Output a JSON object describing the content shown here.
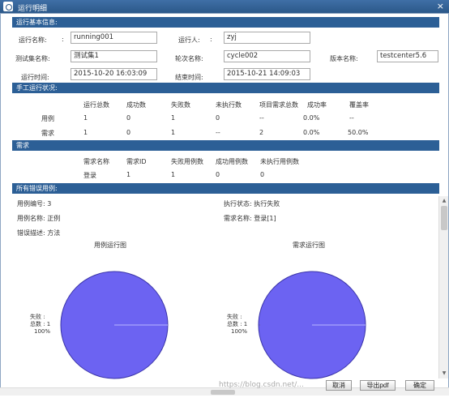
{
  "window": {
    "title": "运行明细",
    "close": "×"
  },
  "sections": {
    "basic": "运行基本信息:",
    "manual": "手工运行状况:",
    "req": "需求",
    "errors": "所有错误用例:"
  },
  "basic": {
    "run_name_label": "运行名称:",
    "run_name": "running001",
    "runner_label": "运行人:",
    "runner": "zyj",
    "testset_label": "测试集名称:",
    "testset": "测试集1",
    "cycle_label": "轮次名称:",
    "cycle": "cycle002",
    "version_label": "版本名称:",
    "version": "testcenter5.6",
    "run_time_label": "运行时间:",
    "run_time": "2015-10-20 16:03:09",
    "end_time_label": "结束时间:",
    "end_time": "2015-10-21 14:09:03"
  },
  "manual": {
    "headers": [
      "运行总数",
      "成功数",
      "失败数",
      "未执行数",
      "项目需求总数",
      "成功率",
      "覆盖率"
    ],
    "rows": [
      {
        "label": "用例",
        "cells": [
          "1",
          "0",
          "1",
          "0",
          "--",
          "0.0%",
          "--"
        ]
      },
      {
        "label": "需求",
        "cells": [
          "1",
          "0",
          "1",
          "--",
          "2",
          "0.0%",
          "50.0%"
        ]
      }
    ]
  },
  "req": {
    "headers": [
      "需求名称",
      "需求ID",
      "失败用例数",
      "成功用例数",
      "未执行用例数"
    ],
    "row": [
      "登录",
      "1",
      "1",
      "0",
      "0"
    ]
  },
  "errors": {
    "case_no": "用例编号: 3",
    "exec_status": "执行状态: 执行失败",
    "case_name": "用例名称: 正例",
    "req_name": "需求名称: 登录[1]",
    "err_desc": "错误描述: 方法"
  },
  "charts": {
    "left_title": "用例运行图",
    "right_title": "需求运行图"
  },
  "chart_data": [
    {
      "type": "pie",
      "title": "用例运行图",
      "categories": [
        "失败"
      ],
      "values": [
        1
      ],
      "labels": [
        "失败 :",
        "总数 : 1",
        "100%"
      ],
      "colors": [
        "#6c63f2"
      ]
    },
    {
      "type": "pie",
      "title": "需求运行图",
      "categories": [
        "失败"
      ],
      "values": [
        1
      ],
      "labels": [
        "失败 :",
        "总数 : 1",
        "100%"
      ],
      "colors": [
        "#6c63f2"
      ]
    }
  ],
  "buttons": {
    "cancel": "取消",
    "export": "导出pdf",
    "confirm": "确定"
  },
  "watermark": "https://blog.csdn.net/..."
}
